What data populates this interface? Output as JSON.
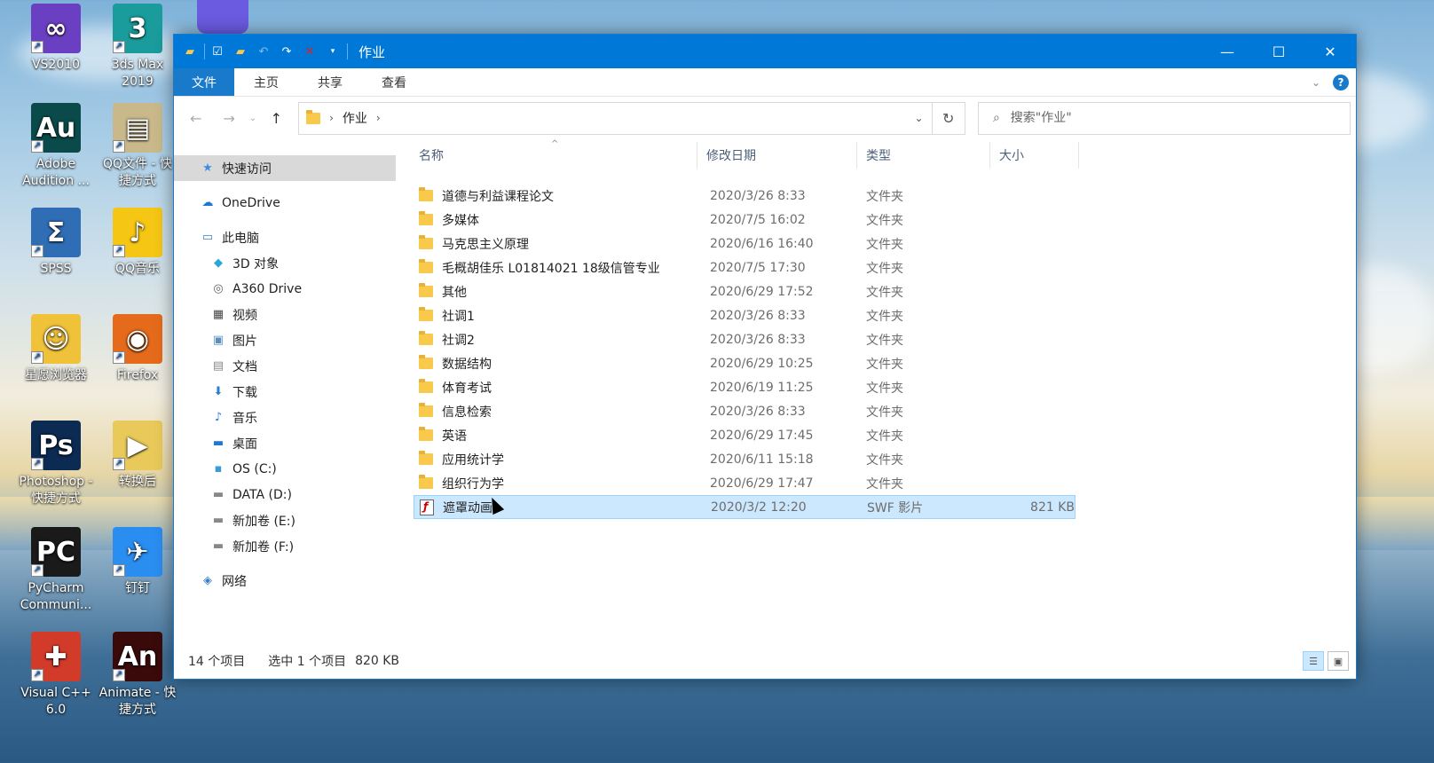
{
  "desktop": {
    "icons": [
      {
        "label": "VS2010",
        "color": "#6a3fc1",
        "glyph": "∞"
      },
      {
        "label": "3ds Max\n2019",
        "color": "#1a9c9c",
        "glyph": "3"
      },
      {
        "label": "Adobe\nAudition ...",
        "color": "#0a4a4a",
        "glyph": "Au"
      },
      {
        "label": "QQ文件 - 快\n捷方式",
        "color": "#c9b98a",
        "glyph": "▤"
      },
      {
        "label": "SPSS",
        "color": "#2f6eb5",
        "glyph": "Σ"
      },
      {
        "label": "QQ音乐",
        "color": "#f5c614",
        "glyph": "♪"
      },
      {
        "label": "星愿浏览器",
        "color": "#f0c23a",
        "glyph": "☺"
      },
      {
        "label": "Firefox",
        "color": "#e66a1b",
        "glyph": "◉"
      },
      {
        "label": "Photoshop -\n快捷方式",
        "color": "#0b2b52",
        "glyph": "Ps"
      },
      {
        "label": "转换后",
        "color": "#e8c95a",
        "glyph": "▶"
      },
      {
        "label": "PyCharm\nCommuni...",
        "color": "#1a1a1a",
        "glyph": "PC"
      },
      {
        "label": "钉钉",
        "color": "#2a8df0",
        "glyph": "✈"
      },
      {
        "label": "Visual C++\n6.0",
        "color": "#d23b2a",
        "glyph": "✚"
      },
      {
        "label": "Animate - 快\n捷方式",
        "color": "#3a0a0a",
        "glyph": "An"
      }
    ]
  },
  "window": {
    "title": "作业",
    "ribbon_tabs": [
      "文件",
      "主页",
      "共享",
      "查看"
    ],
    "help": "?"
  },
  "navbar": {
    "breadcrumb": "作业",
    "search_placeholder": "搜索\"作业\""
  },
  "sidebar": {
    "items": [
      {
        "label": "快速访问",
        "icon": "star-icon",
        "glyph": "★",
        "color": "#3b8ee0"
      },
      {
        "label": "OneDrive",
        "icon": "cloud-icon",
        "glyph": "☁",
        "color": "#1f78d1"
      },
      {
        "label": "此电脑",
        "icon": "computer-icon",
        "glyph": "▭",
        "color": "#3a7fc8"
      },
      {
        "label": "3D 对象",
        "icon": "cube-icon",
        "glyph": "◆",
        "color": "#2aa6d8"
      },
      {
        "label": "A360 Drive",
        "icon": "drive-icon",
        "glyph": "◎",
        "color": "#666666"
      },
      {
        "label": "视频",
        "icon": "video-icon",
        "glyph": "▦",
        "color": "#444444"
      },
      {
        "label": "图片",
        "icon": "pictures-icon",
        "glyph": "▣",
        "color": "#5a8fc0"
      },
      {
        "label": "文档",
        "icon": "documents-icon",
        "glyph": "▤",
        "color": "#888888"
      },
      {
        "label": "下载",
        "icon": "download-icon",
        "glyph": "⬇",
        "color": "#2a7fd0"
      },
      {
        "label": "音乐",
        "icon": "music-icon",
        "glyph": "♪",
        "color": "#2a7fd0"
      },
      {
        "label": "桌面",
        "icon": "desktop-icon",
        "glyph": "▬",
        "color": "#1f78d1"
      },
      {
        "label": "OS (C:)",
        "icon": "windows-drive-icon",
        "glyph": "▪",
        "color": "#3a9ad8"
      },
      {
        "label": "DATA (D:)",
        "icon": "hdd-icon",
        "glyph": "▬",
        "color": "#888888"
      },
      {
        "label": "新加卷 (E:)",
        "icon": "hdd-icon",
        "glyph": "▬",
        "color": "#888888"
      },
      {
        "label": "新加卷 (F:)",
        "icon": "hdd-icon",
        "glyph": "▬",
        "color": "#888888"
      },
      {
        "label": "网络",
        "icon": "network-icon",
        "glyph": "◈",
        "color": "#3a7fc8"
      }
    ]
  },
  "columns": {
    "name": "名称",
    "date": "修改日期",
    "type": "类型",
    "size": "大小"
  },
  "files": [
    {
      "name": "道德与利益课程论文",
      "date": "2020/3/26 8:33",
      "type": "文件夹",
      "size": ""
    },
    {
      "name": "多媒体",
      "date": "2020/7/5 16:02",
      "type": "文件夹",
      "size": ""
    },
    {
      "name": "马克思主义原理",
      "date": "2020/6/16 16:40",
      "type": "文件夹",
      "size": ""
    },
    {
      "name": "毛概胡佳乐 L01814021 18级信管专业",
      "date": "2020/7/5 17:30",
      "type": "文件夹",
      "size": ""
    },
    {
      "name": "其他",
      "date": "2020/6/29 17:52",
      "type": "文件夹",
      "size": ""
    },
    {
      "name": "社调1",
      "date": "2020/3/26 8:33",
      "type": "文件夹",
      "size": ""
    },
    {
      "name": "社调2",
      "date": "2020/3/26 8:33",
      "type": "文件夹",
      "size": ""
    },
    {
      "name": "数据结构",
      "date": "2020/6/29 10:25",
      "type": "文件夹",
      "size": ""
    },
    {
      "name": "体育考试",
      "date": "2020/6/19 11:25",
      "type": "文件夹",
      "size": ""
    },
    {
      "name": "信息检索",
      "date": "2020/3/26 8:33",
      "type": "文件夹",
      "size": ""
    },
    {
      "name": "英语",
      "date": "2020/6/29 17:45",
      "type": "文件夹",
      "size": ""
    },
    {
      "name": "应用统计学",
      "date": "2020/6/11 15:18",
      "type": "文件夹",
      "size": ""
    },
    {
      "name": "组织行为学",
      "date": "2020/6/29 17:47",
      "type": "文件夹",
      "size": ""
    },
    {
      "name": "遮罩动画",
      "date": "2020/3/2 12:20",
      "type": "SWF 影片",
      "size": "821 KB",
      "selected": true,
      "kind": "swf"
    }
  ],
  "status": {
    "count": "14 个项目",
    "selection": "选中 1 个项目",
    "selection_size": "820 KB"
  }
}
